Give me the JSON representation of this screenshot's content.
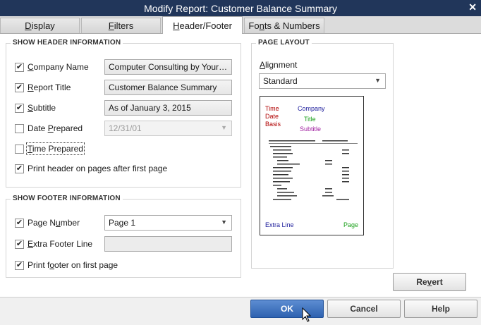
{
  "window": {
    "title": "Modify Report: Customer Balance Summary",
    "close_glyph": "✕"
  },
  "tabs": [
    {
      "label": "Display",
      "underline_index": 0
    },
    {
      "label": "Filters",
      "underline_index": 0
    },
    {
      "label": "Header/Footer",
      "underline_index": 0,
      "active": true
    },
    {
      "label": "Fonts & Numbers",
      "underline_index": 2
    }
  ],
  "header_section": {
    "legend": "SHOW HEADER INFORMATION",
    "company_name": {
      "pre": "",
      "u": "C",
      "post": "ompany Name",
      "checked": true,
      "value": "Computer Consulting by Your ..."
    },
    "report_title": {
      "pre": "",
      "u": "R",
      "post": "eport Title",
      "checked": true,
      "value": "Customer Balance Summary"
    },
    "subtitle": {
      "pre": "",
      "u": "S",
      "post": "ubtitle",
      "checked": true,
      "value": "As of January 3, 2015"
    },
    "date_prepared": {
      "pre": "Date ",
      "u": "P",
      "post": "repared",
      "checked": false,
      "value": "12/31/01"
    },
    "time_prepared": {
      "pre": "",
      "u": "T",
      "post": "ime Prepared",
      "checked": false
    },
    "print_header": {
      "pre": "Print header on pa",
      "u": "g",
      "post": "es after first page",
      "checked": true
    }
  },
  "footer_section": {
    "legend": "SHOW FOOTER INFORMATION",
    "page_number": {
      "pre": "Page N",
      "u": "u",
      "post": "mber",
      "checked": true,
      "value": "Page 1"
    },
    "extra_footer": {
      "pre": "",
      "u": "E",
      "post": "xtra Footer Line",
      "checked": true,
      "value": ""
    },
    "print_footer": {
      "pre": "Print f",
      "u": "o",
      "post": "oter on first page",
      "checked": true
    }
  },
  "page_layout": {
    "legend": "PAGE LAYOUT",
    "alignment_label_u": "A",
    "alignment_label_rest": "lignment",
    "alignment_value": "Standard",
    "preview": {
      "time": "Time",
      "date": "Date",
      "basis": "Basis",
      "company": "Company",
      "title": "Title",
      "subtitle": "Subtitle",
      "extra_line": "Extra Line",
      "page": "Page",
      "colors": {
        "time": "#b00000",
        "company": "#1a1a9a",
        "title": "#1aa01a",
        "subtitle": "#a020a0",
        "extra": "#1a1a9a",
        "page": "#1aa01a"
      }
    }
  },
  "buttons": {
    "revert": {
      "u": "v",
      "pre": "Re",
      "post": "ert"
    },
    "ok": "OK",
    "cancel": "Cancel",
    "help": "Help"
  },
  "checkmark": "✔",
  "dropdown_arrow": "▼"
}
